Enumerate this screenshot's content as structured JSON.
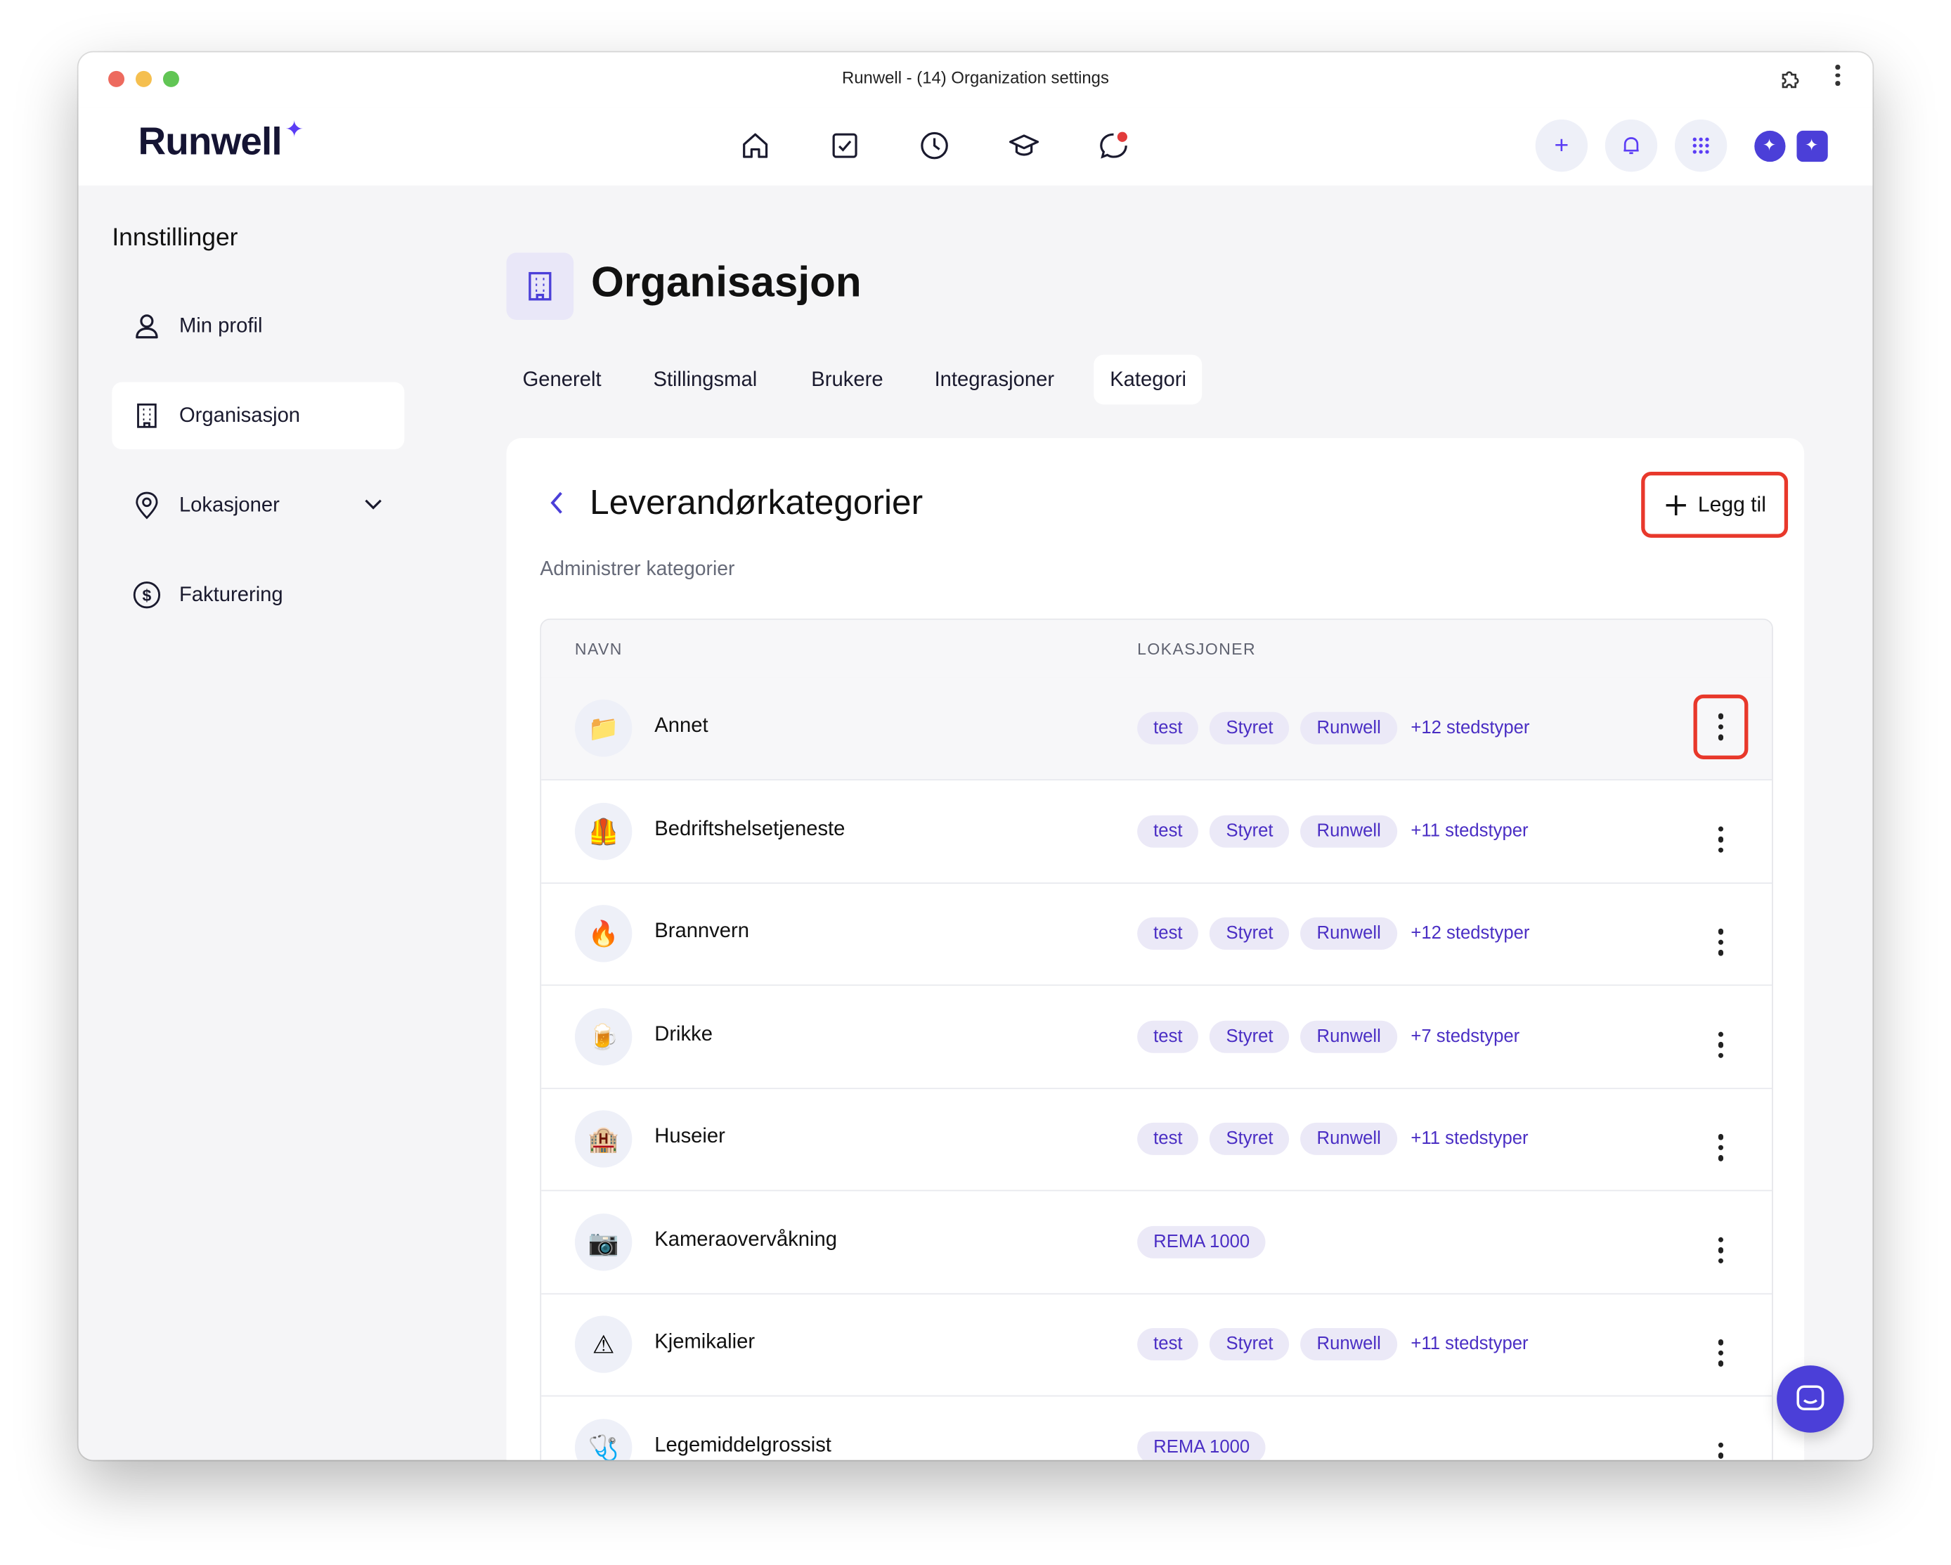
{
  "window": {
    "title": "Runwell - (14) Organization settings"
  },
  "brand": {
    "logo": "Runwell",
    "accent_color": "#5b3df5"
  },
  "top_nav": {
    "icons": [
      "home-icon",
      "tasks-icon",
      "clock-icon",
      "education-icon",
      "chat-icon"
    ],
    "right_buttons": [
      "plus-icon",
      "bell-icon",
      "apps-grid-icon",
      "assistant-icon"
    ]
  },
  "sidebar": {
    "title": "Innstillinger",
    "items": [
      {
        "label": "Min profil",
        "icon": "user-icon"
      },
      {
        "label": "Organisasjon",
        "icon": "building-icon",
        "active": true
      },
      {
        "label": "Lokasjoner",
        "icon": "location-pin-icon",
        "expandable": true
      },
      {
        "label": "Fakturering",
        "icon": "dollar-icon"
      }
    ]
  },
  "page": {
    "title": "Organisasjon",
    "tabs": [
      {
        "label": "Generelt"
      },
      {
        "label": "Stillingsmal"
      },
      {
        "label": "Brukere"
      },
      {
        "label": "Integrasjoner"
      },
      {
        "label": "Kategori",
        "active": true
      }
    ]
  },
  "card": {
    "title": "Leverandørkategorier",
    "subtitle": "Administrer kategorier",
    "add_button": "Legg til"
  },
  "table": {
    "columns": [
      "NAVN",
      "LOKASJONER"
    ],
    "rows": [
      {
        "emoji": "📁",
        "name": "Annet",
        "tags": [
          "test",
          "Styret",
          "Runwell"
        ],
        "more": "+12 stedstyper"
      },
      {
        "emoji": "🦺",
        "name": "Bedriftshelsetjeneste",
        "tags": [
          "test",
          "Styret",
          "Runwell"
        ],
        "more": "+11 stedstyper"
      },
      {
        "emoji": "🔥",
        "name": "Brannvern",
        "tags": [
          "test",
          "Styret",
          "Runwell"
        ],
        "more": "+12 stedstyper"
      },
      {
        "emoji": "🍺",
        "name": "Drikke",
        "tags": [
          "test",
          "Styret",
          "Runwell"
        ],
        "more": "+7 stedstyper"
      },
      {
        "emoji": "🏨",
        "name": "Huseier",
        "tags": [
          "test",
          "Styret",
          "Runwell"
        ],
        "more": "+11 stedstyper"
      },
      {
        "emoji": "📷",
        "name": "Kameraovervåkning",
        "tags": [
          "REMA 1000"
        ],
        "more": ""
      },
      {
        "emoji": "⚠",
        "name": "Kjemikalier",
        "tags": [
          "test",
          "Styret",
          "Runwell"
        ],
        "more": "+11 stedstyper"
      },
      {
        "emoji": "🩺",
        "name": "Legemiddelgrossist",
        "tags": [
          "REMA 1000"
        ],
        "more": ""
      }
    ]
  }
}
